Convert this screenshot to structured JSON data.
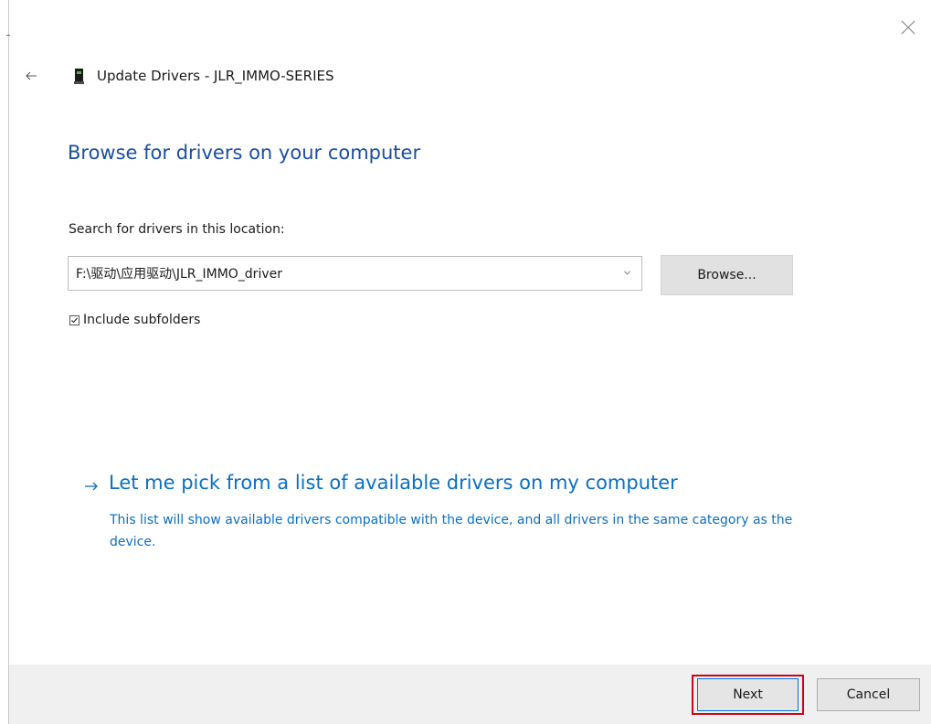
{
  "window": {
    "title": "Update Drivers - JLR_IMMO-SERIES"
  },
  "page": {
    "heading": "Browse for drivers on your computer"
  },
  "search": {
    "label": "Search for drivers in this location:",
    "path_value": "F:\\驱动\\应用驱动\\JLR_IMMO_driver",
    "browse_label": "Browse..."
  },
  "subfolders": {
    "label": "Include subfolders",
    "checked": true
  },
  "pick_link": {
    "title": "Let me pick from a list of available drivers on my computer",
    "description": "This list will show available drivers compatible with the device, and all drivers in the same category as the device."
  },
  "footer": {
    "next_label": "Next",
    "cancel_label": "Cancel"
  },
  "colors": {
    "heading": "#1a4fa0",
    "link": "#0a6fc2",
    "highlight": "#d0021b",
    "footer_bg": "#f0f0f0"
  }
}
